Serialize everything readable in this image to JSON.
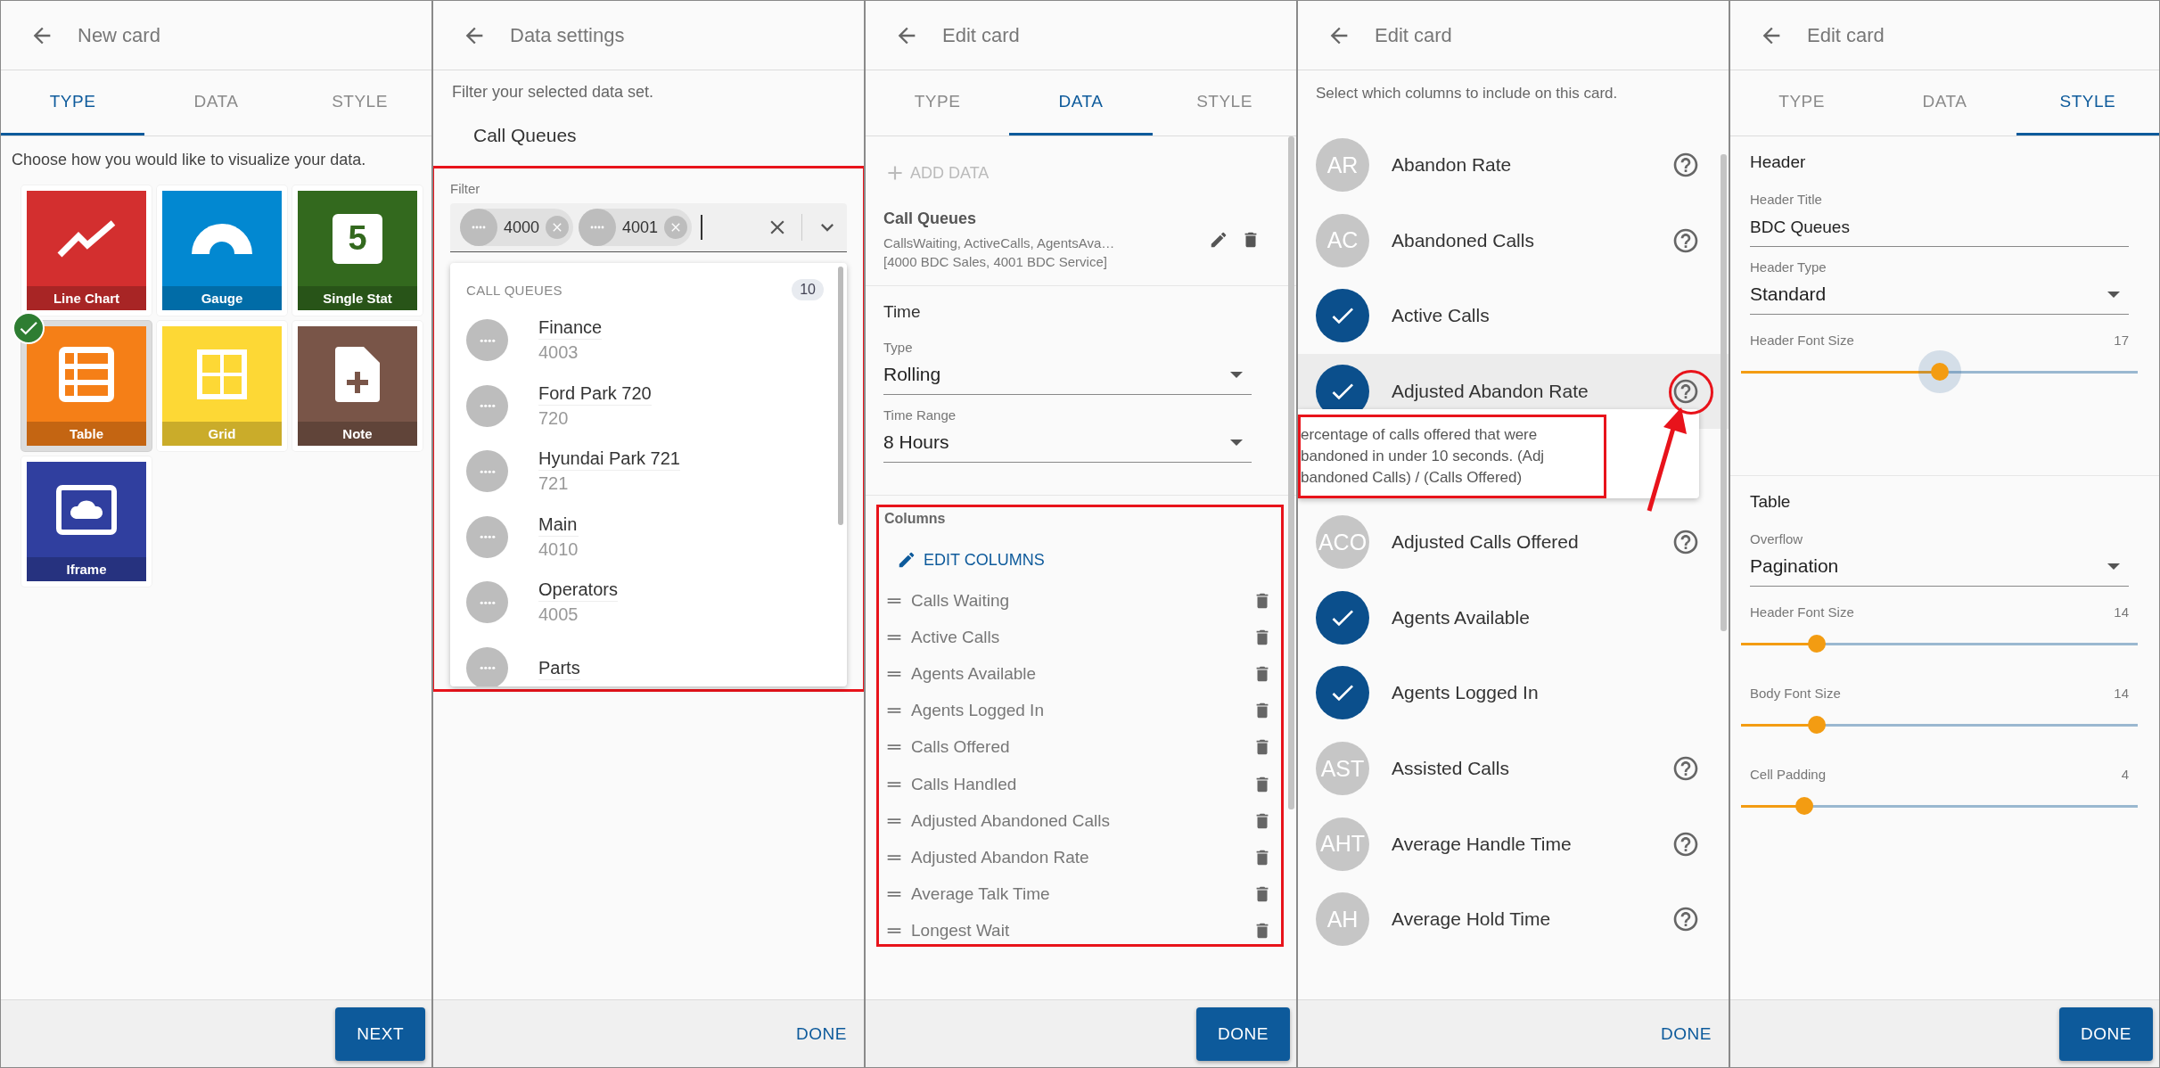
{
  "new_card": {
    "title": "New card",
    "tabs": [
      {
        "label": "TYPE",
        "selected": true
      },
      {
        "label": "DATA",
        "selected": false
      },
      {
        "label": "STYLE",
        "selected": false
      }
    ],
    "intro": "Choose how you would like to visualize your data.",
    "tiles": [
      {
        "label": "Line Chart",
        "kind": "line",
        "color": "#d32f2f",
        "selected": false
      },
      {
        "label": "Gauge",
        "kind": "gauge",
        "color": "#0288d1",
        "selected": false
      },
      {
        "label": "Single Stat",
        "kind": "stat",
        "glyph": "5",
        "color": "#33691e",
        "selected": false
      },
      {
        "label": "Table",
        "kind": "table",
        "color": "#f57f17",
        "selected": true
      },
      {
        "label": "Grid",
        "kind": "grid",
        "color": "#fdd835",
        "selected": false
      },
      {
        "label": "Note",
        "kind": "note",
        "color": "#795548",
        "selected": false
      },
      {
        "label": "Iframe",
        "kind": "iframe",
        "color": "#303f9f",
        "selected": false
      }
    ],
    "footer_button": {
      "label": "NEXT",
      "kind": "filled"
    }
  },
  "data_settings": {
    "title": "Data settings",
    "intro": "Filter your selected data set.",
    "dataset": "Call Queues",
    "filter": {
      "label": "Filter",
      "chips": [
        "4000",
        "4001"
      ],
      "menu": {
        "heading": "CALL QUEUES",
        "count": "10",
        "items": [
          {
            "name": "Finance",
            "number": "4003"
          },
          {
            "name": "Ford Park 720",
            "number": "720"
          },
          {
            "name": "Hyundai Park 721",
            "number": "721"
          },
          {
            "name": "Main",
            "number": "4010"
          },
          {
            "name": "Operators",
            "number": "4005"
          },
          {
            "name": "Parts"
          }
        ]
      }
    },
    "footer_button": {
      "label": "DONE",
      "kind": "text"
    }
  },
  "edit_data": {
    "title": "Edit card",
    "tabs": [
      {
        "label": "TYPE",
        "selected": false
      },
      {
        "label": "DATA",
        "selected": true
      },
      {
        "label": "STYLE",
        "selected": false
      }
    ],
    "add_data": {
      "label": "ADD DATA",
      "disabled": true
    },
    "source": {
      "name": "Call Queues",
      "columns": "CallsWaiting, ActiveCalls, AgentsAva…",
      "filter": "[4000 BDC Sales, 4001 BDC Service]"
    },
    "time": {
      "heading": "Time",
      "fields": [
        {
          "kind": "select",
          "label": "Type",
          "value": "Rolling"
        },
        {
          "kind": "select",
          "label": "Time Range",
          "value": "8 Hours"
        }
      ]
    },
    "columns": {
      "heading": "Columns",
      "edit_label": "EDIT COLUMNS",
      "items": [
        "Calls Waiting",
        "Active Calls",
        "Agents Available",
        "Agents Logged In",
        "Calls Offered",
        "Calls Handled",
        "Adjusted Abandoned Calls",
        "Adjusted Abandon Rate",
        "Average Talk Time",
        "Longest Wait"
      ]
    },
    "footer_button": {
      "label": "DONE",
      "kind": "filled"
    }
  },
  "edit_columns": {
    "title": "Edit card",
    "intro": "Select which columns to include on this card.",
    "rows": [
      {
        "label": "Abandon Rate",
        "initials": "AR",
        "checked": false,
        "help": true
      },
      {
        "label": "Abandoned Calls",
        "initials": "AC",
        "checked": false,
        "help": true
      },
      {
        "label": "Active Calls",
        "checked": true,
        "help": false
      },
      {
        "label": "Adjusted Abandon Rate",
        "checked": true,
        "help": true,
        "tooltip": "ercentage of calls offered that were\nbandoned in under 10 seconds. (Adj\nbandoned Calls) / (Calls Offered)"
      },
      {
        "label": "Adjusted Calls Offered",
        "initials": "ACO",
        "checked": false,
        "help": true
      },
      {
        "label": "Agents Available",
        "checked": true,
        "help": false
      },
      {
        "label": "Agents Logged In",
        "checked": true,
        "help": false
      },
      {
        "label": "Assisted Calls",
        "initials": "AST",
        "checked": false,
        "help": true
      },
      {
        "label": "Average Handle Time",
        "initials": "AHT",
        "checked": false,
        "help": true
      },
      {
        "label": "Average Hold Time",
        "initials": "AH",
        "checked": false,
        "help": true
      }
    ],
    "footer_button": {
      "label": "DONE",
      "kind": "text"
    }
  },
  "edit_style": {
    "title": "Edit card",
    "tabs": [
      {
        "label": "TYPE",
        "selected": false
      },
      {
        "label": "DATA",
        "selected": false
      },
      {
        "label": "STYLE",
        "selected": true
      }
    ],
    "sections": [
      {
        "title": "Header",
        "fields": [
          {
            "kind": "text",
            "label": "Header Title",
            "value": "BDC Queues"
          },
          {
            "kind": "select",
            "label": "Header Type",
            "value": "Standard"
          },
          {
            "kind": "slider",
            "label": "Header Font Size",
            "reading": "17",
            "level": 0.5,
            "focused": true
          }
        ]
      },
      {
        "title": "Table",
        "fields": [
          {
            "kind": "select",
            "label": "Overflow",
            "value": "Pagination"
          },
          {
            "kind": "slider",
            "label": "Header Font Size",
            "reading": "14",
            "level": 0.19,
            "focused": false
          },
          {
            "kind": "slider",
            "label": "Body Font Size",
            "reading": "14",
            "level": 0.19,
            "focused": false
          },
          {
            "kind": "slider",
            "label": "Cell Padding",
            "reading": "4",
            "level": 0.16,
            "focused": false
          }
        ]
      }
    ],
    "footer_button": {
      "label": "DONE",
      "kind": "filled"
    }
  }
}
